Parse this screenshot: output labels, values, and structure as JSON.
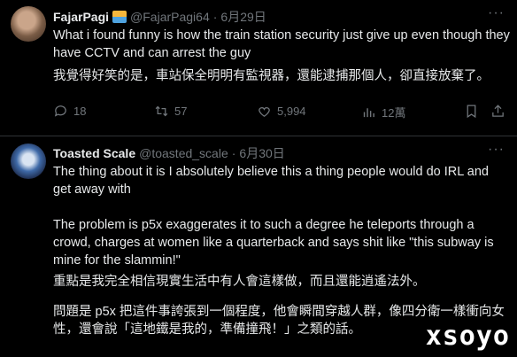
{
  "tweets": [
    {
      "name": "FajarPagi",
      "handle": "@FajarPagi64",
      "date": "6月29日",
      "text_en": "What i found funny is how the train station security just give up even though they have CCTV and can arrest the guy",
      "text_zh": "我覺得好笑的是，車站保全明明有監視器，還能逮捕那個人，卻直接放棄了。",
      "replies": "18",
      "reposts": "57",
      "likes": "5,994",
      "views": "12萬"
    },
    {
      "name": "Toasted Scale",
      "handle": "@toasted_scale",
      "date": "6月30日",
      "text_en_1": "The thing about it is I absolutely believe this a thing people would do IRL and get away with",
      "text_en_2": "The problem is p5x exaggerates it to such a degree he teleports through a crowd, charges at women like a quarterback and says shit like \"this subway is mine for the slammin!\"",
      "text_zh_1": "重點是我完全相信現實生活中有人會這樣做，而且還能逍遙法外。",
      "text_zh_2": "問題是 p5x 把這件事誇張到一個程度，他會瞬間穿越人群，像四分衛一樣衝向女性，還會說「這地鐵是我的，準備撞飛！」之類的話。"
    }
  ],
  "separator": "·",
  "watermark": "xsoyo",
  "icons": [
    "more-icon",
    "reply-icon",
    "repost-icon",
    "like-icon",
    "views-icon",
    "bookmark-icon",
    "share-icon"
  ]
}
